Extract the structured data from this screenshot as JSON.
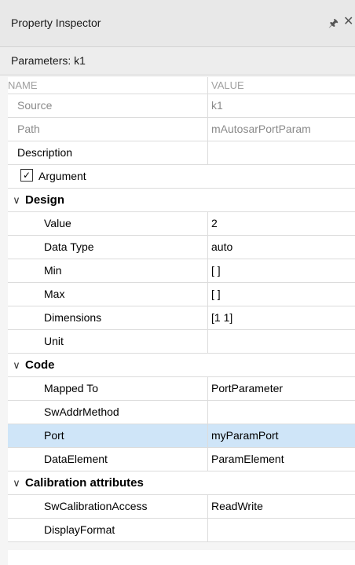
{
  "window": {
    "title": "Property Inspector",
    "pin_icon": "pin-icon",
    "close_icon": "close-icon"
  },
  "context": {
    "label": "Parameters: k1"
  },
  "columns": {
    "name": "NAME",
    "value": "VALUE"
  },
  "general": {
    "source": {
      "name": "Source",
      "value": "k1"
    },
    "path": {
      "name": "Path",
      "value": "mAutosarPortParam"
    },
    "description": {
      "name": "Description",
      "value": ""
    },
    "argument": {
      "label": "Argument",
      "checked": true
    }
  },
  "design": {
    "label": "Design",
    "rows": [
      {
        "name": "Value",
        "value": "2"
      },
      {
        "name": "Data Type",
        "value": "auto"
      },
      {
        "name": "Min",
        "value": "[ ]"
      },
      {
        "name": "Max",
        "value": "[ ]"
      },
      {
        "name": "Dimensions",
        "value": "[1 1]"
      },
      {
        "name": "Unit",
        "value": ""
      }
    ]
  },
  "code": {
    "label": "Code",
    "rows": [
      {
        "name": "Mapped To",
        "value": "PortParameter"
      },
      {
        "name": "SwAddrMethod",
        "value": ""
      },
      {
        "name": "Port",
        "value": "myParamPort"
      },
      {
        "name": "DataElement",
        "value": "ParamElement"
      }
    ],
    "selected_row": "Port"
  },
  "calibration": {
    "label": "Calibration attributes",
    "rows": [
      {
        "name": "SwCalibrationAccess",
        "value": "ReadWrite"
      },
      {
        "name": "DisplayFormat",
        "value": ""
      }
    ]
  },
  "colors": {
    "selected_row": "#cfe5f8",
    "grid_line": "#dcdcdc"
  }
}
